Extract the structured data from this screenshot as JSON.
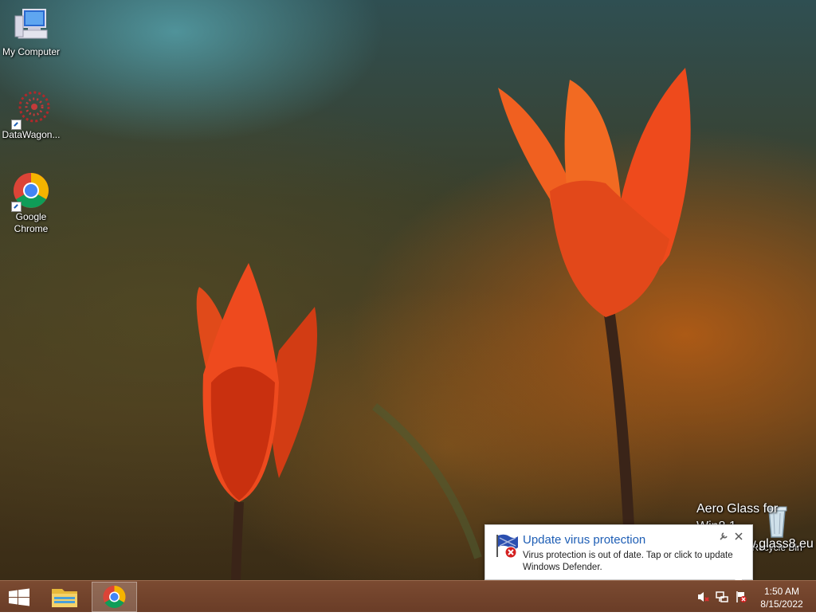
{
  "desktop": {
    "icons": [
      {
        "label": "My Computer",
        "icon": "computer-icon"
      },
      {
        "label": "DataWagon...",
        "icon": "datawagon-icon"
      },
      {
        "label": "Google Chrome",
        "icon": "chrome-icon"
      },
      {
        "label": "Recycle Bin",
        "icon": "recycle-bin-icon"
      }
    ],
    "watermark": {
      "line1": "Aero Glass for Win8.1",
      "line2": "http://www.glass8.eu"
    }
  },
  "notification": {
    "title": "Update virus protection",
    "body": "Virus protection is out of date. Tap or click to update Windows Defender.",
    "icon": "defender-warning-icon",
    "title_color": "#1e5eb5"
  },
  "taskbar": {
    "start_icon": "windows-start-icon",
    "pinned": [
      {
        "icon": "file-explorer-icon",
        "active": false
      },
      {
        "icon": "chrome-icon",
        "active": true
      }
    ],
    "tray": [
      {
        "icon": "speaker-muted-icon"
      },
      {
        "icon": "network-icon"
      },
      {
        "icon": "action-center-error-icon"
      }
    ],
    "clock": {
      "time": "1:50 AM",
      "date": "8/15/2022"
    },
    "color": "#6f4129"
  }
}
